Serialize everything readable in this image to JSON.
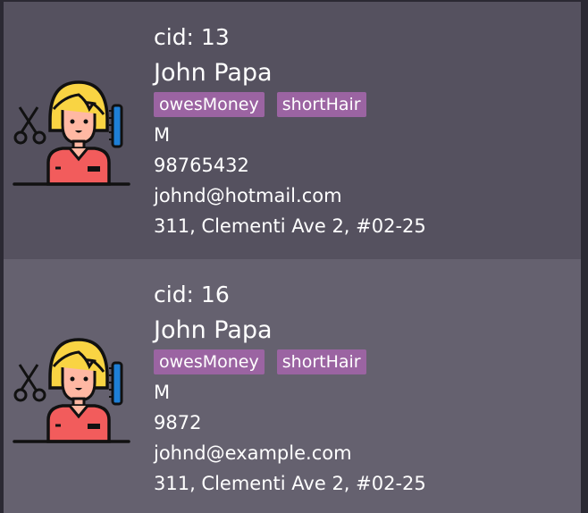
{
  "persons": [
    {
      "cid": "cid: 13",
      "name": "John Papa",
      "tags": [
        "owesMoney",
        "shortHair"
      ],
      "gender": "M",
      "phone": "98765432",
      "email": "johnd@hotmail.com",
      "address": "311,    Clementi Ave 2, #02-25"
    },
    {
      "cid": "cid: 16",
      "name": "John Papa",
      "tags": [
        "owesMoney",
        "shortHair"
      ],
      "gender": "M",
      "phone": "9872",
      "email": "johnd@example.com",
      "address": "311,    Clementi Ave 2, #02-25"
    }
  ],
  "colors": {
    "card_even": "#55515f",
    "card_odd": "#65616f",
    "tag_bg": "#9b64a2",
    "text": "#ffffff"
  },
  "icons": {
    "avatar": "hairdresser-avatar-icon"
  }
}
